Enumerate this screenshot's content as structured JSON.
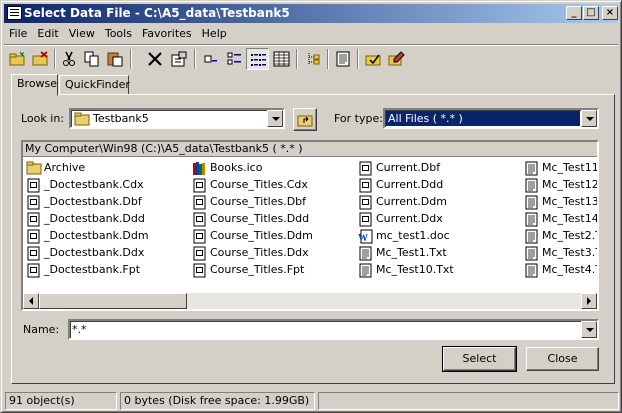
{
  "title": "Select Data File - C:\\A5_data\\Testbank5",
  "menu": [
    "File",
    "Edit",
    "View",
    "Tools",
    "Favorites",
    "Help"
  ],
  "tabs": [
    "Browse",
    "QuickFinder"
  ],
  "look_in": {
    "label": "Look in:",
    "value": "Testbank5"
  },
  "for_type": {
    "label": "For type:",
    "value": "All Files ( *.* )"
  },
  "path": "My Computer\\Win98 (C:)\\A5_data\\Testbank5    ( *.* )",
  "files": [
    [
      {
        "name": "Archive",
        "icon": "folder-icon"
      },
      {
        "name": "_Doctestbank.Cdx",
        "icon": "file-icon"
      },
      {
        "name": "_Doctestbank.Dbf",
        "icon": "file-icon"
      },
      {
        "name": "_Doctestbank.Ddd",
        "icon": "file-icon"
      },
      {
        "name": "_Doctestbank.Ddm",
        "icon": "file-icon"
      },
      {
        "name": "_Doctestbank.Ddx",
        "icon": "file-icon"
      },
      {
        "name": "_Doctestbank.Fpt",
        "icon": "file-icon"
      }
    ],
    [
      {
        "name": "Books.ico",
        "icon": "books-icon"
      },
      {
        "name": "Course_Titles.Cdx",
        "icon": "file-icon"
      },
      {
        "name": "Course_Titles.Dbf",
        "icon": "file-icon"
      },
      {
        "name": "Course_Titles.Ddd",
        "icon": "file-icon"
      },
      {
        "name": "Course_Titles.Ddm",
        "icon": "file-icon"
      },
      {
        "name": "Course_Titles.Ddx",
        "icon": "file-icon"
      },
      {
        "name": "Course_Titles.Fpt",
        "icon": "file-icon"
      }
    ],
    [
      {
        "name": "Current.Dbf",
        "icon": "file-icon"
      },
      {
        "name": "Current.Ddd",
        "icon": "file-icon"
      },
      {
        "name": "Current.Ddm",
        "icon": "file-icon"
      },
      {
        "name": "Current.Ddx",
        "icon": "file-icon"
      },
      {
        "name": "mc_test1.doc",
        "icon": "word-doc-icon"
      },
      {
        "name": "Mc_Test1.Txt",
        "icon": "text-file-icon"
      },
      {
        "name": "Mc_Test10.Txt",
        "icon": "text-file-icon"
      }
    ],
    [
      {
        "name": "Mc_Test11.",
        "icon": "text-file-icon"
      },
      {
        "name": "Mc_Test12.",
        "icon": "text-file-icon"
      },
      {
        "name": "Mc_Test13.",
        "icon": "text-file-icon"
      },
      {
        "name": "Mc_Test14.",
        "icon": "text-file-icon"
      },
      {
        "name": "Mc_Test2.T",
        "icon": "text-file-icon"
      },
      {
        "name": "Mc_Test3.T",
        "icon": "text-file-icon"
      },
      {
        "name": "Mc_Test4.T",
        "icon": "text-file-icon"
      }
    ]
  ],
  "name_field": {
    "label": "Name:",
    "value": "*.*"
  },
  "buttons": {
    "select": "Select",
    "close": "Close"
  },
  "status": {
    "objects": "91 object(s)",
    "disk": "0 bytes (Disk free space: 1.99GB)"
  },
  "colors": {
    "title_start": "#0a246a",
    "title_end": "#a6caf0",
    "selection": "#0a246a",
    "face": "#d4d0c8"
  }
}
